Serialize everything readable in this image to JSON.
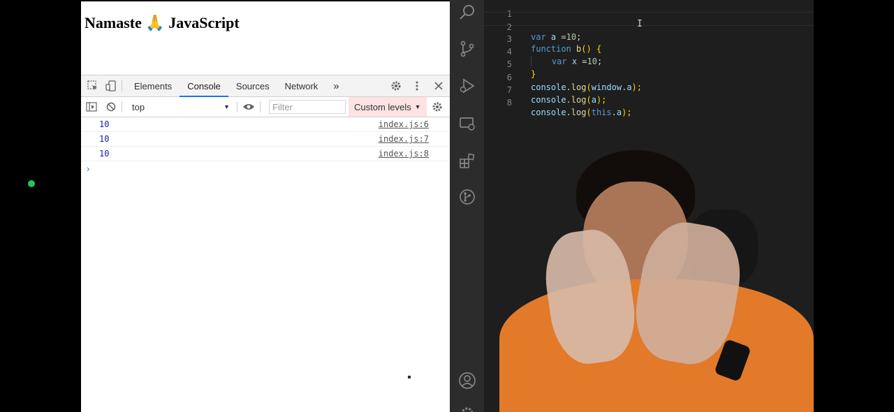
{
  "page": {
    "title": "Namaste 🙏 JavaScript"
  },
  "devtools": {
    "tabs": [
      {
        "label": "Elements"
      },
      {
        "label": "Console",
        "active": true
      },
      {
        "label": "Sources"
      },
      {
        "label": "Network"
      }
    ],
    "more_tabs_label": "»",
    "context": "top",
    "filter_placeholder": "Filter",
    "levels_label": "Custom levels",
    "console_rows": [
      {
        "value": "10",
        "source": "index.js:6"
      },
      {
        "value": "10",
        "source": "index.js:7"
      },
      {
        "value": "10",
        "source": "index.js:8"
      }
    ],
    "prompt": "›"
  },
  "editor": {
    "lines": [
      {
        "num": "1"
      },
      {
        "num": "2"
      },
      {
        "num": "3"
      },
      {
        "num": "4"
      },
      {
        "num": "5"
      },
      {
        "num": "6"
      },
      {
        "num": "7"
      },
      {
        "num": "8"
      }
    ],
    "tokens": {
      "l2": [
        "var",
        "a",
        "=",
        "10",
        ";"
      ],
      "l3": [
        "function",
        "b",
        "()",
        "{"
      ],
      "l4": [
        "var",
        "x",
        "=",
        "10",
        ";"
      ],
      "l5": [
        "}"
      ],
      "l6": [
        "console",
        ".log",
        "(",
        "window",
        ".",
        "a",
        ");"
      ],
      "l7": [
        "console",
        ".log",
        "(",
        "a",
        ");"
      ],
      "l8": [
        "console",
        ".log",
        "(",
        "this",
        ".",
        "a",
        ");"
      ]
    }
  },
  "colors": {
    "accent": "#1a73e8",
    "console_value": "#1a1aa6",
    "status_dot": "#22c55e",
    "levels_bg": "#fde3e3"
  },
  "icons": {
    "activity": [
      "search-icon",
      "source-control-icon",
      "run-debug-icon",
      "remote-explorer-icon",
      "extensions-icon",
      "git-graph-icon",
      "account-icon"
    ]
  }
}
